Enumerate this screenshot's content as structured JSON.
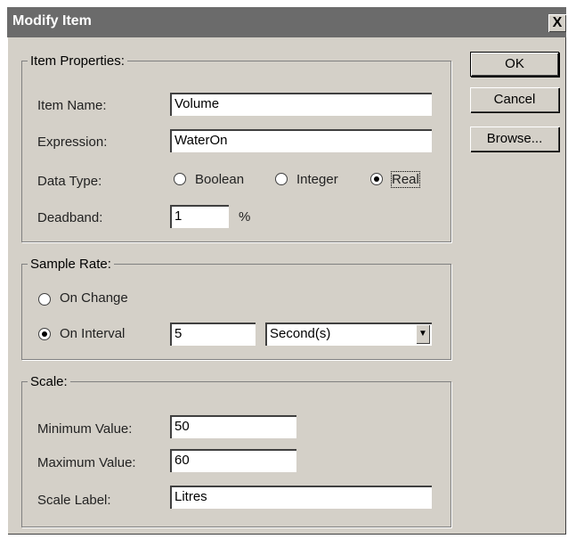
{
  "window": {
    "title": "Modify Item",
    "close_symbol": "X"
  },
  "buttons": {
    "ok": "OK",
    "cancel": "Cancel",
    "browse": "Browse..."
  },
  "item_properties": {
    "legend": "Item Properties:",
    "item_name_label": "Item Name:",
    "item_name_value": "Volume",
    "expression_label": "Expression:",
    "expression_value": "WaterOn",
    "data_type_label": "Data Type:",
    "data_type_options": [
      "Boolean",
      "Integer",
      "Real"
    ],
    "data_type_selected": "Real",
    "deadband_label": "Deadband:",
    "deadband_value": "1",
    "deadband_unit": "%"
  },
  "sample_rate": {
    "legend": "Sample Rate:",
    "on_change_label": "On Change",
    "on_interval_label": "On Interval",
    "selected": "On Interval",
    "interval_value": "5",
    "interval_unit": "Second(s)"
  },
  "scale": {
    "legend": "Scale:",
    "min_label": "Minimum Value:",
    "min_value": "50",
    "max_label": "Maximum Value:",
    "max_value": "60",
    "scale_label_label": "Scale Label:",
    "scale_label_value": "Litres"
  },
  "icons": {
    "close": "close-icon",
    "dropdown": "chevron-down-icon",
    "radio": "radio-icon"
  },
  "colors": {
    "dialog_bg": "#d4d0c8",
    "titlebar": "#6b6b6b"
  }
}
